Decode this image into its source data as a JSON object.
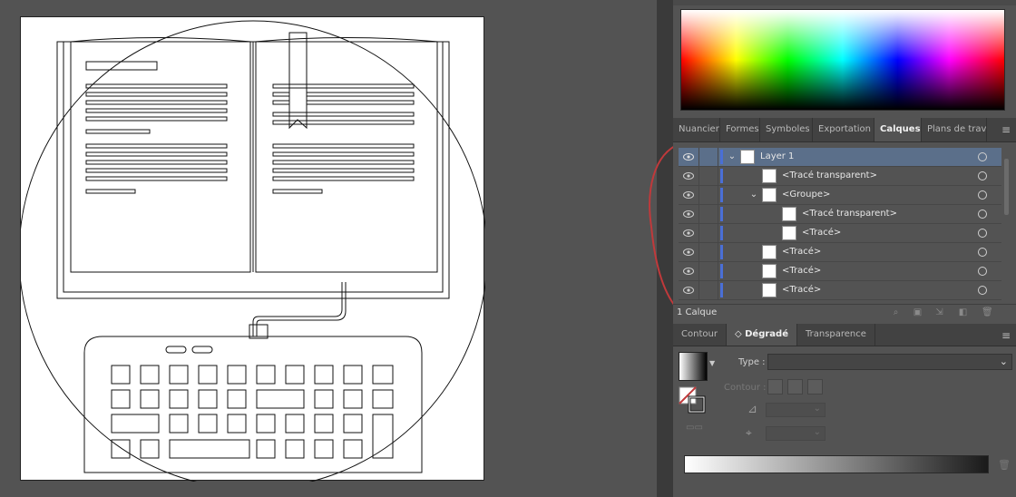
{
  "colors": {
    "accent_selection": "#5b6f8a",
    "layer_color": "#4a6fd6",
    "panel_bg": "#535353",
    "annotation": "#c0393b"
  },
  "layers_panel": {
    "tabs": [
      {
        "label": "Nuancier",
        "active": false
      },
      {
        "label": "Formes",
        "active": false
      },
      {
        "label": "Symboles",
        "active": false
      },
      {
        "label": "Exportation d",
        "active": false
      },
      {
        "label": "Calques",
        "active": true
      },
      {
        "label": "Plans de trav",
        "active": false
      }
    ],
    "rows": [
      {
        "label": "Layer 1",
        "selected": true,
        "expanded": true
      },
      {
        "label": "<Tracé transparent>"
      },
      {
        "label": "<Groupe>",
        "expanded": true
      },
      {
        "label": "<Tracé transparent>"
      },
      {
        "label": "<Tracé>"
      },
      {
        "label": "<Tracé>"
      },
      {
        "label": "<Tracé>"
      },
      {
        "label": "<Tracé>"
      }
    ],
    "footer_label": "1 Calque"
  },
  "gradient_panel": {
    "tabs": [
      {
        "label": "Contour",
        "active": false
      },
      {
        "label": "Dégradé",
        "active": true
      },
      {
        "label": "Transparence",
        "active": false
      }
    ],
    "type_label": "Type :",
    "type_value": "",
    "contour_label": "Contour :"
  },
  "icons": [
    "eye-icon",
    "chevron-down-icon",
    "target-circle-icon",
    "search-icon",
    "new-sublayer-icon",
    "new-layer-icon",
    "trash-icon",
    "panel-menu-icon",
    "angle-icon",
    "aspect-ratio-icon"
  ]
}
